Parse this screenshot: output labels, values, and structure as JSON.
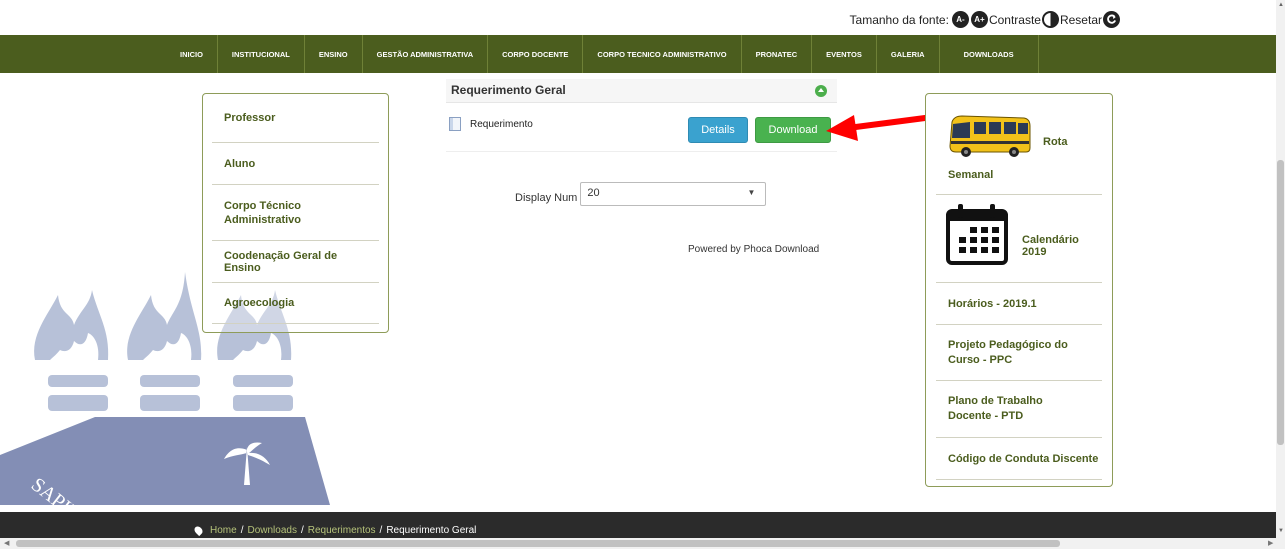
{
  "accessibility": {
    "font_size_label": "Tamanho da fonte:",
    "decrease_label": "A-",
    "increase_label": "A+",
    "contrast_label": "Contraste",
    "reset_label": "Resetar"
  },
  "nav": {
    "items": [
      "INICIO",
      "INSTITUCIONAL",
      "ENSINO",
      "GESTÃO ADMINISTRATIVA",
      "CORPO DOCENTE",
      "CORPO TECNICO ADMINISTRATIVO",
      "PRONATEC",
      "EVENTOS",
      "GALERIA",
      "DOWNLOADS"
    ]
  },
  "left_menu": {
    "items": [
      "Professor",
      "Aluno",
      "Corpo Técnico Administrativo",
      "Coodenação Geral de Ensino",
      "Agroecologia"
    ]
  },
  "content": {
    "section_title": "Requerimento Geral",
    "file_name": "Requerimento",
    "details_label": "Details",
    "download_label": "Download",
    "display_num_label": "Display Num",
    "display_num_value": "20",
    "powered_by": "Powered by ",
    "powered_link": "Phoca Download"
  },
  "right_menu": {
    "rota_label": "Rota",
    "semanal_label": "Semanal",
    "calendario_label": "Calendário 2019",
    "horarios_label": "Horários - 2019.1",
    "ppc_label": "Projeto Pedagógico do Curso - PPC",
    "ptd_label": "Plano de Trabalho Docente - PTD",
    "conduta_label": "Código de Conduta Discente"
  },
  "footer": {
    "breadcrumb": [
      "Home",
      "Downloads",
      "Requerimentos",
      "Requerimento Geral"
    ],
    "separator": "/"
  },
  "watermark": {
    "text": "SAPIE"
  },
  "colors": {
    "nav_bg": "#4b5d1e",
    "accent_text": "#4b5d1e",
    "details_button": "#3aa2cf",
    "download_button": "#49b24f",
    "annotation_arrow": "#ff0000",
    "footer_bg": "#2b2b2b"
  }
}
